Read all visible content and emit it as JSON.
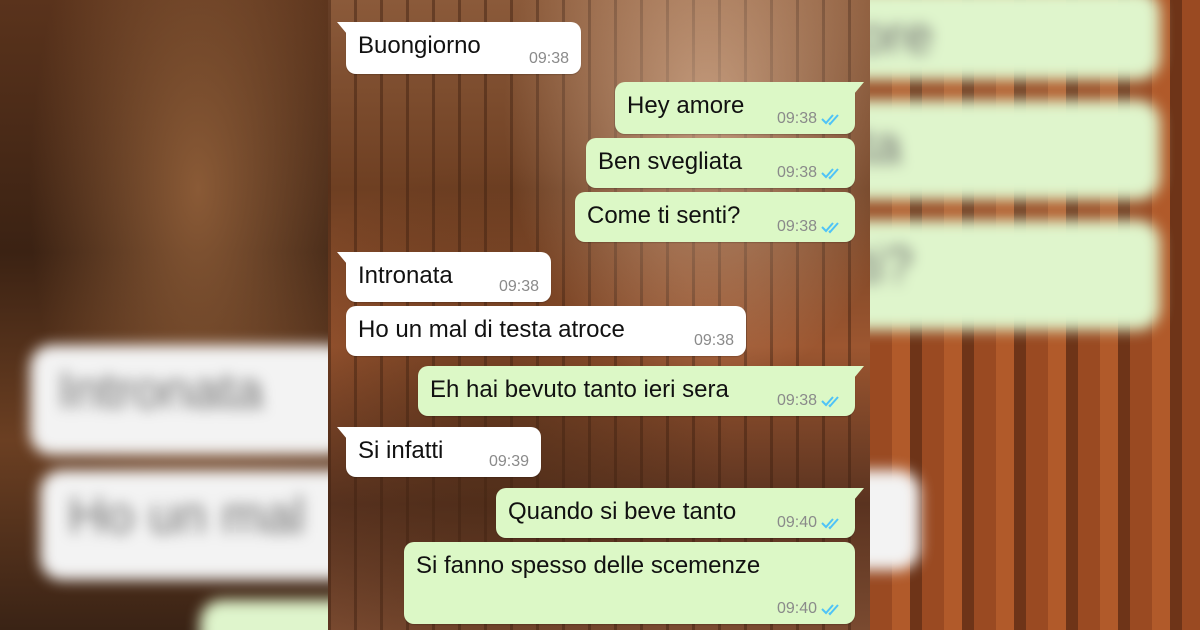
{
  "messages": [
    {
      "dir": "in",
      "text": "Buongiorno",
      "time": "09:38"
    },
    {
      "dir": "out",
      "text": "Hey amore",
      "time": "09:38"
    },
    {
      "dir": "out",
      "text": "Ben svegliata",
      "time": "09:38"
    },
    {
      "dir": "out",
      "text": "Come ti senti?",
      "time": "09:38"
    },
    {
      "dir": "in",
      "text": "Intronata",
      "time": "09:38"
    },
    {
      "dir": "in",
      "text": "Ho un mal di testa atroce",
      "time": "09:38"
    },
    {
      "dir": "out",
      "text": "Eh hai bevuto tanto ieri sera",
      "time": "09:38"
    },
    {
      "dir": "in",
      "text": "Si infatti",
      "time": "09:39"
    },
    {
      "dir": "out",
      "text": "Quando si beve tanto",
      "time": "09:40"
    },
    {
      "dir": "out",
      "text": "Si fanno spesso delle scemenze",
      "time": "09:40"
    }
  ],
  "blurred_left": [
    "Intronata",
    "Ho un mal"
  ],
  "blurred_right": [
    "ore",
    "ta",
    "ti?"
  ],
  "colors": {
    "incoming_bubble": "#ffffff",
    "outgoing_bubble": "#dcf8c6",
    "read_ticks": "#4fc3f7",
    "timestamp": "#8a8a8a"
  },
  "icons": {
    "read_receipt": "double-check-icon"
  }
}
